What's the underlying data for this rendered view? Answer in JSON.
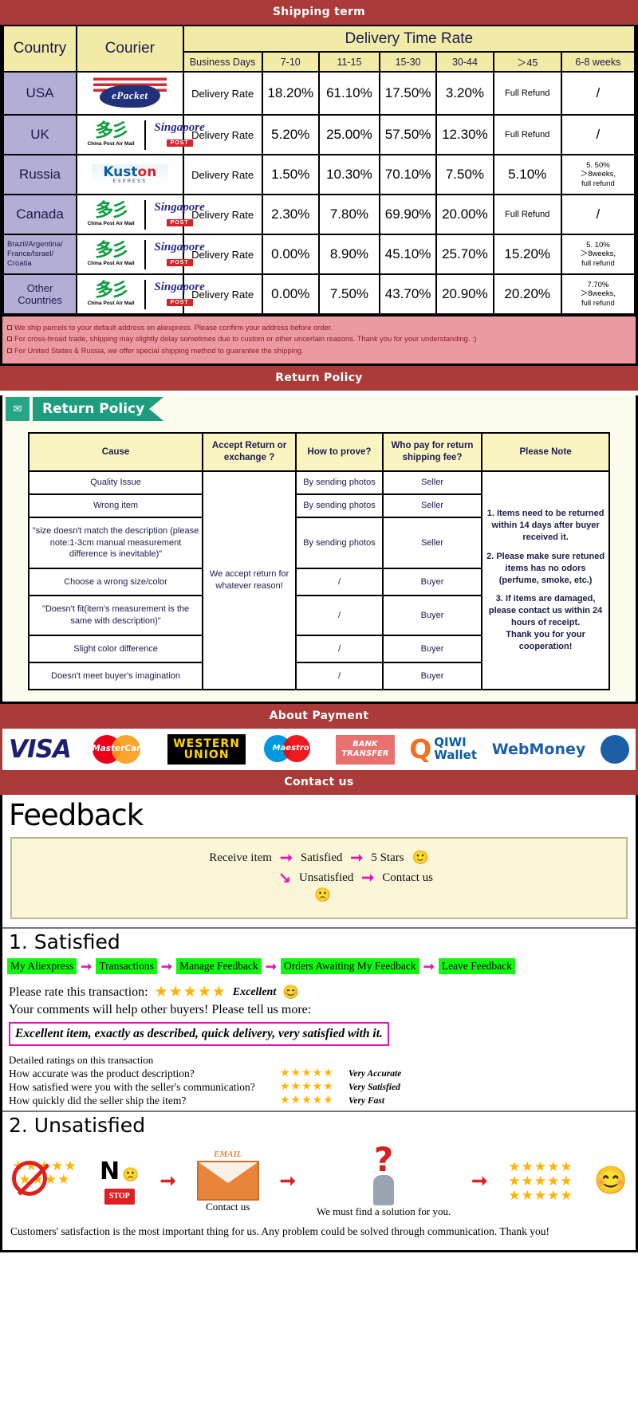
{
  "banners": {
    "shipping": "Shipping term",
    "return": "Return Policy",
    "payment": "About Payment",
    "contact": "Contact us"
  },
  "shipping_table": {
    "col_country": "Country",
    "col_courier": "Courier",
    "col_delivery_time_rate": "Delivery Time Rate",
    "subheaders": [
      "Business Days",
      "7-10",
      "11-15",
      "15-30",
      "30-44",
      "＞45",
      "6-8 weeks"
    ],
    "rows": [
      {
        "country": "USA",
        "couriers": [
          "ePacket"
        ],
        "rate_label": "Delivery Rate",
        "values": [
          "18.20%",
          "61.10%",
          "17.50%",
          "3.20%",
          "Full Refund",
          "/"
        ]
      },
      {
        "country": "UK",
        "couriers": [
          "China Post Air Mail",
          "Singapore POST"
        ],
        "rate_label": "Delivery Rate",
        "values": [
          "5.20%",
          "25.00%",
          "57.50%",
          "12.30%",
          "Full Refund",
          "/"
        ]
      },
      {
        "country": "Russia",
        "couriers": [
          "Kuston EXPRESS"
        ],
        "rate_label": "Delivery Rate",
        "values": [
          "1.50%",
          "10.30%",
          "70.10%",
          "7.50%",
          "5.10%",
          "5. 50%\n＞8weeks,\nfull refund"
        ]
      },
      {
        "country": "Canada",
        "couriers": [
          "China Post Air Mail",
          "Singapore POST"
        ],
        "rate_label": "Delivery Rate",
        "values": [
          "2.30%",
          "7.80%",
          "69.90%",
          "20.00%",
          "Full Refund",
          "/"
        ]
      },
      {
        "country": "Brazil/Argentina/France/Israel/Croatia",
        "couriers": [
          "China Post Air Mail",
          "Singapore POST"
        ],
        "rate_label": "Delivery Rate",
        "values": [
          "0.00%",
          "8.90%",
          "45.10%",
          "25.70%",
          "15.20%",
          "5. 10%\n＞8weeks,\nfull refund"
        ]
      },
      {
        "country": "Other Countries",
        "couriers": [
          "China Post Air Mail",
          "Singapore POST"
        ],
        "rate_label": "Delivery Rate",
        "values": [
          "0.00%",
          "7.50%",
          "43.70%",
          "20.90%",
          "20.20%",
          "7.70%\n＞8weeks,\nfull refund"
        ]
      }
    ],
    "notes": [
      "We ship parcels to your default address on aliexpress. Please confirm your address before order.",
      "For cross-broad trade, shipping may slightly delay sometimes due to custom or other uncertain reasons. Thank you for your understanding. :)",
      "For United States & Russia, we offer special shipping method to guarantee the shipping."
    ]
  },
  "return_policy": {
    "ribbon_label": "Return Policy",
    "headers": [
      "Cause",
      "Accept Return or exchange ?",
      "How to prove?",
      "Who pay for return shipping fee?",
      "Please Note"
    ],
    "accept_text": "We accept return for whatever reason!",
    "rows": [
      {
        "cause": "Quality Issue",
        "prove": "By sending photos",
        "payer": "Seller"
      },
      {
        "cause": "Wrong item",
        "prove": "By sending photos",
        "payer": "Seller"
      },
      {
        "cause": "\"size doesn't match the description (please note:1-3cm manual measurement difference is inevitable)\"",
        "prove": "By sending photos",
        "payer": "Seller"
      },
      {
        "cause": "Choose a wrong size/color",
        "prove": "/",
        "payer": "Buyer"
      },
      {
        "cause": "\"Doesn't fit(item's measurement is the same with description)\"",
        "prove": "/",
        "payer": "Buyer"
      },
      {
        "cause": "Slight color difference",
        "prove": "/",
        "payer": "Buyer"
      },
      {
        "cause": "Doesn't meet buyer's imagination",
        "prove": "/",
        "payer": "Buyer"
      }
    ],
    "notes": [
      "1. Items need to be returned within 14 days after buyer received it.",
      "2. Please make sure retuned items has no odors (perfume, smoke, etc.)",
      "3. If items are damaged, please contact us within 24 hours of receipt.",
      "Thank you for your cooperation!"
    ]
  },
  "payment_methods": [
    {
      "name": "VISA",
      "icon": "visa-logo"
    },
    {
      "name": "MasterCard",
      "icon": "mastercard-logo"
    },
    {
      "name": "WESTERN UNION",
      "line1": "WESTERN",
      "line2": "UNION",
      "icon": "western-union-logo"
    },
    {
      "name": "Maestro",
      "icon": "maestro-logo"
    },
    {
      "name": "BANK TRANSFER",
      "line1": "BANK",
      "line2": "TRANSFER",
      "icon": "bank-transfer-logo"
    },
    {
      "name": "QIWI Wallet",
      "line1": "QIWI",
      "line2": "Wallet",
      "icon": "qiwi-wallet-logo"
    },
    {
      "name": "WebMoney",
      "icon": "webmoney-logo"
    }
  ],
  "feedback": {
    "title": "Feedback",
    "flow": {
      "start": "Receive item",
      "satisfied": "Satisfied",
      "five_stars": "5 Stars",
      "unsatisfied": "Unsatisfied",
      "contact_us": "Contact us",
      "happy_face": "🙂",
      "sad_face": "🙁"
    },
    "satisfied": {
      "heading": "1. Satisfied",
      "chain": [
        "My Aliexpress",
        "Transactions",
        "Manage Feedback",
        "Orders Awaiting My Feedback",
        "Leave Feedback"
      ],
      "rate_label": "Please rate this transaction:",
      "stars": "★★★★★",
      "rating_word": "Excellent",
      "smiley": "😊",
      "comment_prompt": "Your comments will help other buyers! Please tell us more:",
      "sample_comment": "Excellent item, exactly as described, quick delivery, very satisfied with it.",
      "detail_heading": "Detailed ratings on this transaction",
      "detail_rows": [
        {
          "question": "How accurate was the product description?",
          "stars": "★★★★★",
          "value": "Very Accurate"
        },
        {
          "question": "How satisfied were you with the seller's communication?",
          "stars": "★★★★★",
          "value": "Very Satisfied"
        },
        {
          "question": "How quickly did the seller ship the item?",
          "stars": "★★★★★",
          "value": "Very Fast"
        }
      ]
    },
    "unsatisfied": {
      "heading": "2. Unsatisfied",
      "no_label": "N",
      "stop_label": "STOP",
      "email_label": "EMAIL",
      "contact_caption": "Contact us",
      "solution_caption": "We must find a solution for you.",
      "stars_block": "★★★★★",
      "smiley": "😊",
      "closing": "Customers' satisfaction is the most important thing for us. Any problem could be solved through communication. Thank you!"
    }
  }
}
